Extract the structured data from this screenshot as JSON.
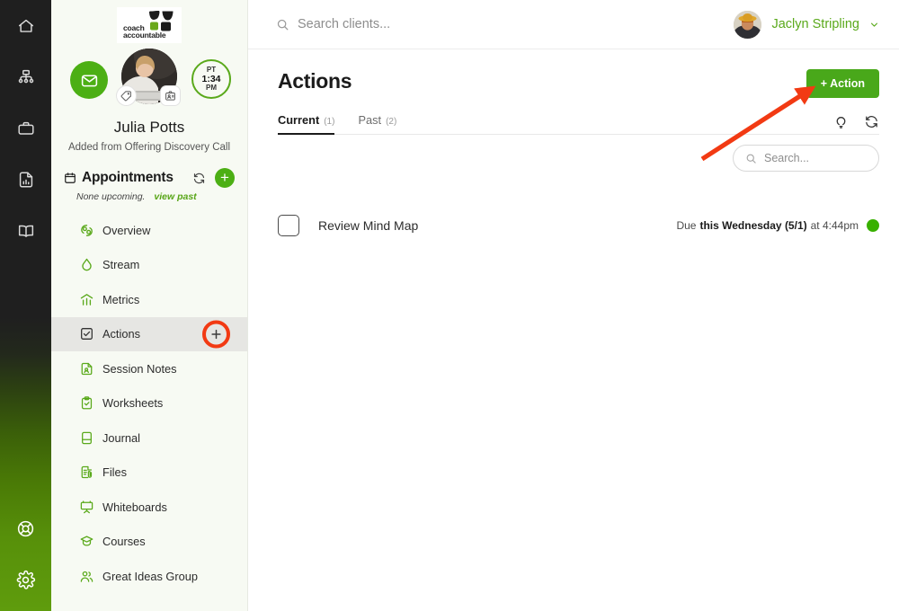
{
  "rail": {
    "top_items": [
      {
        "name": "home-icon",
        "label": "Home"
      },
      {
        "name": "org-chart-icon",
        "label": "Teams"
      },
      {
        "name": "briefcase-icon",
        "label": "Business"
      },
      {
        "name": "report-icon",
        "label": "Reports"
      },
      {
        "name": "book-icon",
        "label": "Library"
      }
    ],
    "bottom_items": [
      {
        "name": "lifebuoy-icon",
        "label": "Help"
      },
      {
        "name": "gear-icon",
        "label": "Settings"
      }
    ]
  },
  "sidebar": {
    "logo": {
      "line1": "coach",
      "line2": "accountable"
    },
    "client": {
      "name": "Julia Potts",
      "source": "Added from Offering Discovery Call",
      "timezone_abbr": "PT",
      "time": "1:34",
      "meridiem": "PM"
    },
    "appointments": {
      "title": "Appointments",
      "status": "None upcoming.",
      "view_past": "view past",
      "add_label": "+"
    },
    "nav": [
      {
        "label": "Overview",
        "icon": "overview-leaf-icon",
        "active": false
      },
      {
        "label": "Stream",
        "icon": "droplet-icon",
        "active": false
      },
      {
        "label": "Metrics",
        "icon": "metrics-chart-icon",
        "active": false
      },
      {
        "label": "Actions",
        "icon": "checkbox-icon",
        "active": true
      },
      {
        "label": "Session Notes",
        "icon": "session-notes-icon",
        "active": false
      },
      {
        "label": "Worksheets",
        "icon": "clipboard-check-icon",
        "active": false
      },
      {
        "label": "Journal",
        "icon": "journal-book-icon",
        "active": false
      },
      {
        "label": "Files",
        "icon": "file-attachment-icon",
        "active": false
      },
      {
        "label": "Whiteboards",
        "icon": "whiteboard-easel-icon",
        "active": false
      },
      {
        "label": "Courses",
        "icon": "graduation-cap-icon",
        "active": false
      },
      {
        "label": "Great Ideas Group",
        "icon": "people-group-icon",
        "active": false
      }
    ]
  },
  "topbar": {
    "search_placeholder": "Search clients...",
    "user_name": "Jaclyn Stripling"
  },
  "page": {
    "title": "Actions",
    "add_button": "+ Action",
    "tabs": [
      {
        "label": "Current",
        "count": "(1)",
        "active": true
      },
      {
        "label": "Past",
        "count": "(2)",
        "active": false
      }
    ],
    "list_search_placeholder": "Search...",
    "items": [
      {
        "name": "Review Mind Map",
        "due_prefix": "Due",
        "due_strong": "this Wednesday (5/1)",
        "due_suffix": "at 4:44pm",
        "status_color": "#38b000"
      }
    ]
  },
  "colors": {
    "brand_green": "#4caf14",
    "button_green": "#49a81a",
    "link_green": "#5aa91b",
    "annotation_red": "#f23a13",
    "status_green": "#38b000"
  }
}
